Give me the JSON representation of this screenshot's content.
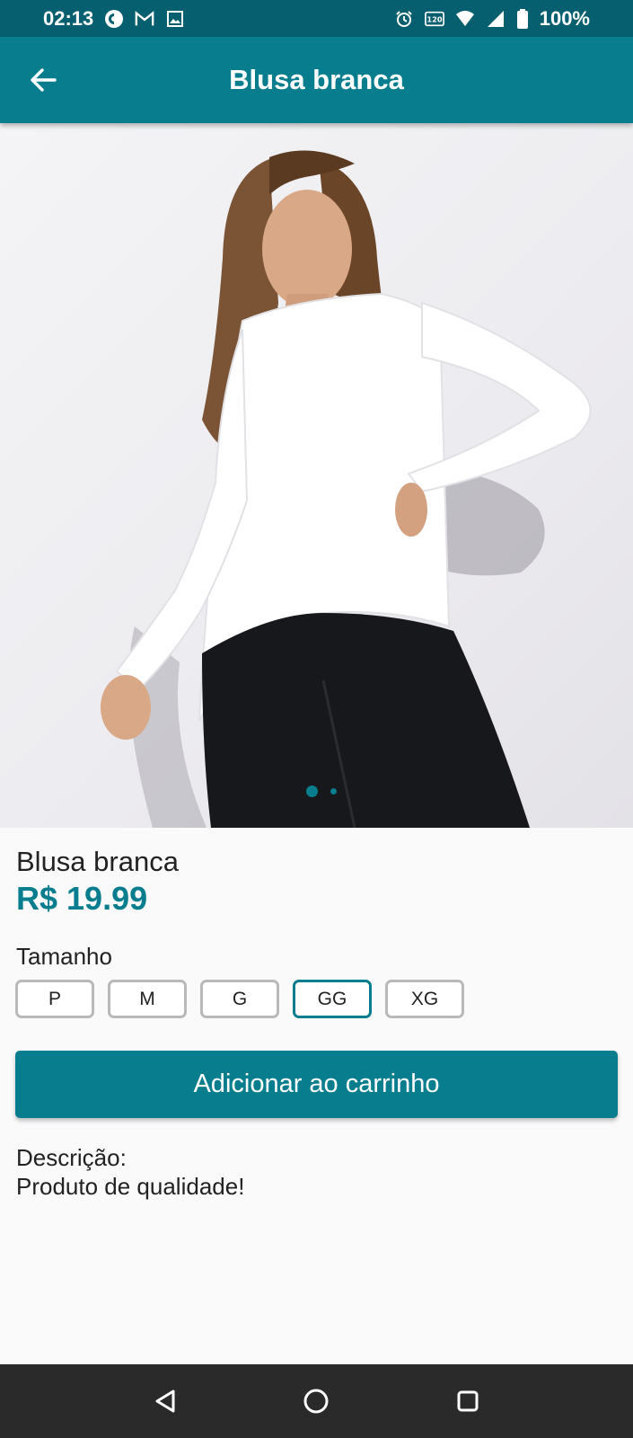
{
  "status_bar": {
    "time": "02:13",
    "battery": "100%",
    "left_icons": [
      "pocket-casts-icon",
      "gmail-icon",
      "image-icon"
    ],
    "right_icons": [
      "alarm-icon",
      "refresh-rate-120-icon",
      "wifi-icon",
      "signal-icon",
      "battery-icon"
    ]
  },
  "app_bar": {
    "title": "Blusa branca",
    "back_icon": "arrow-left-icon",
    "color": "#087d8d"
  },
  "gallery": {
    "image_description": "model-wearing-white-long-sleeve-blouse",
    "current_index": 1,
    "total_images": 2
  },
  "product": {
    "name": "Blusa branca",
    "price": "R$ 19.99",
    "price_color": "#087d8d"
  },
  "size": {
    "label": "Tamanho",
    "options": [
      "P",
      "M",
      "G",
      "GG",
      "XG"
    ],
    "selected": "GG"
  },
  "cart_button": {
    "label": "Adicionar ao carrinho"
  },
  "description": {
    "title": "Descrição:",
    "text": "Produto de qualidade!"
  },
  "nav_bar": {
    "icons": [
      "back-triangle-icon",
      "home-circle-icon",
      "recents-square-icon"
    ]
  }
}
